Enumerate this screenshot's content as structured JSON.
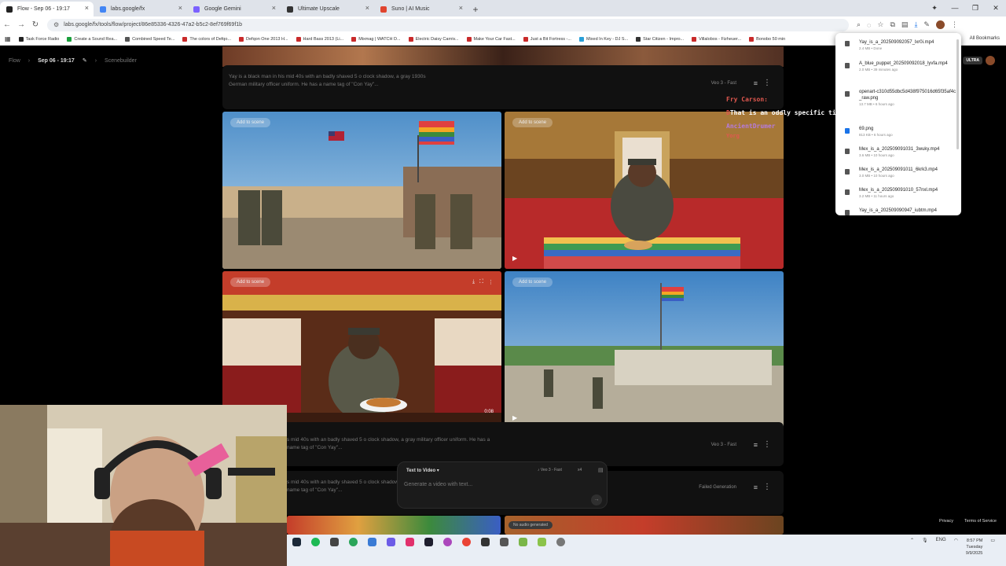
{
  "browser": {
    "tabs": [
      {
        "title": "Flow - Sep 06 - 19:17",
        "favicon_color": "#222222",
        "active": true
      },
      {
        "title": "labs.google/fx",
        "favicon_color": "#4285f4"
      },
      {
        "title": "Google Gemini",
        "favicon_color": "#7b61ff"
      },
      {
        "title": "Ultimate Upscale",
        "favicon_color": "#333333"
      },
      {
        "title": "Suno | AI Music",
        "favicon_color": "#e0442e"
      }
    ],
    "new_tab": "+",
    "url": "labs.google/fx/tools/flow/project/86e85336-4326-47a2-b5c2-8ef769f69f1b",
    "bookmarks": [
      {
        "label": "Task Force Radio",
        "color": "#222"
      },
      {
        "label": "Create a Sound Rea...",
        "color": "#1a9f3c"
      },
      {
        "label": "Combined Speed Te...",
        "color": "#555"
      },
      {
        "label": "The colors of Defqo...",
        "color": "#c92a2a"
      },
      {
        "label": "Defqon One 2013 H...",
        "color": "#c92a2a"
      },
      {
        "label": "Hard Bass 2013 (Li...",
        "color": "#c92a2a"
      },
      {
        "label": "Mixmag | WATCH D...",
        "color": "#c92a2a"
      },
      {
        "label": "Electric Daisy Carniv...",
        "color": "#c92a2a"
      },
      {
        "label": "Make Your Car Fast...",
        "color": "#c92a2a"
      },
      {
        "label": "Just a Bit Fortress -...",
        "color": "#c92a2a"
      },
      {
        "label": "Mixed In Key - DJ S...",
        "color": "#29a0d8"
      },
      {
        "label": "Star Citizen - Impro...",
        "color": "#333"
      },
      {
        "label": "Villalobos - Fizheuer...",
        "color": "#c92a2a"
      },
      {
        "label": "Bonobo 50 min",
        "color": "#c92a2a"
      }
    ],
    "all_bookmarks": "All Bookmarks"
  },
  "app": {
    "breadcrumb": {
      "root": "Flow",
      "project": "Sep 06 - 19:17",
      "page": "Scenebuilder"
    },
    "plan_badge": "ULTRA",
    "prompt_text": "Yay is a black man in his mid 40s with an badly shaved 5 o clock shadow, a gray 1930s German military officer uniform. He has a name tag of \"Con Yay\"...",
    "prompt_text_partial": "s mid 40s with an badly shaved 5 o clock shadow, a gray military officer uniform. He has a name tag of \"Con Yay\"...",
    "model_label": "Veo 3 - Fast",
    "failed_label": "Failed Generation",
    "add_to_scene": "Add to scene",
    "video_time": "0:08",
    "no_audio": "No audio generated",
    "text_to_video": {
      "mode": "Text to Video",
      "model": "Veo 3 - Fast",
      "qty": "x4",
      "placeholder": "Generate a video with text..."
    },
    "footer": {
      "privacy": "Privacy",
      "terms": "Terms of Service"
    }
  },
  "downloads": [
    {
      "name": "Yay_is_a_202509092057_lxr0i.mp4",
      "meta": "2.4 MB • Done"
    },
    {
      "name": "A_blue_puppet_202509092018_lyvfa.mp4",
      "meta": "2.0 MB • 39 minutes ago"
    },
    {
      "name": "openart-c310d55dbc5d438f975016d65f35af4c_raw.png",
      "meta": "13.7 MB • 6 hours ago"
    },
    {
      "name": "69.png",
      "meta": "813 KB • 6 hours ago"
    },
    {
      "name": "Mex_is_a_202509091031_3wuky.mp4",
      "meta": "3.6 MB • 10 hours ago"
    },
    {
      "name": "Mex_is_a_202509091011_6krk3.mp4",
      "meta": "3.0 MB • 10 hours ago"
    },
    {
      "name": "Mex_is_a_202509091010_57nxl.mp4",
      "meta": "3.2 MB • 11 hours ago"
    },
    {
      "name": "Yay_is_a_202509090947_iubtm.mp4",
      "meta": ""
    }
  ],
  "chat": {
    "user1": "Fry Carson:",
    "message_prefix": "D",
    "message": "That is an oddly specific time",
    "user2": "AncientDrumer",
    "user2_tail": "Yorg"
  },
  "taskbar": {
    "lang": "ENG",
    "time": "8:57 PM",
    "day": "Tuesday",
    "date": "9/9/2025"
  }
}
